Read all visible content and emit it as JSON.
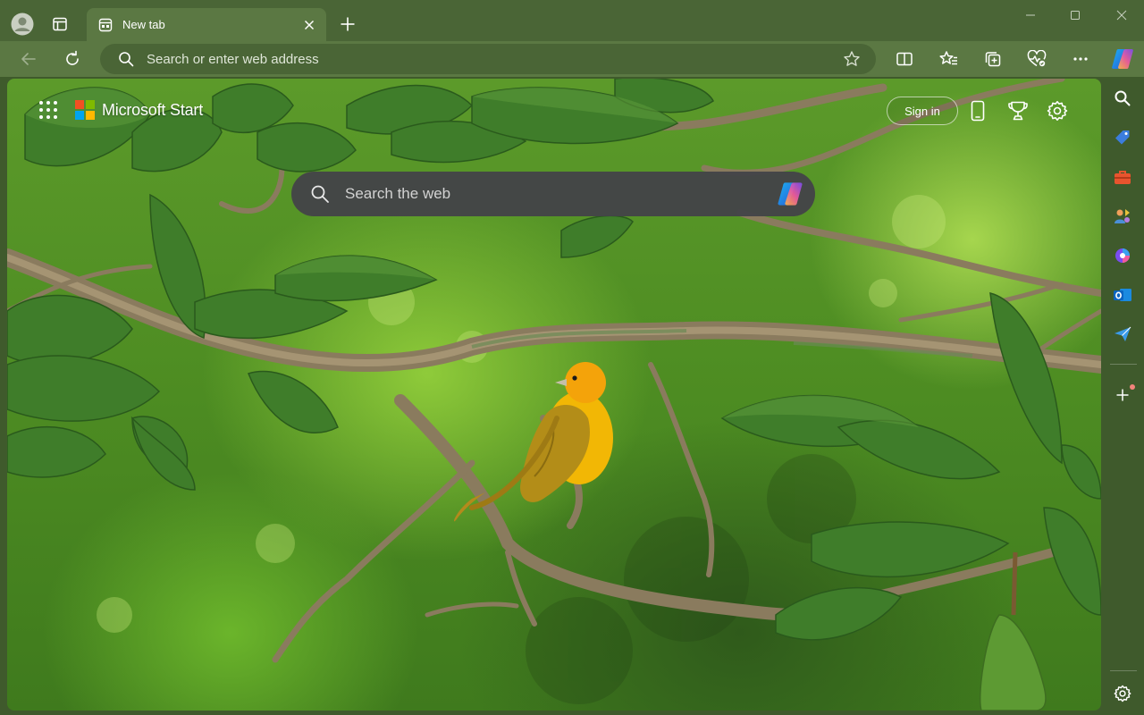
{
  "window": {
    "tab_title": "New tab",
    "minimize_glyph": "—",
    "maximize_glyph": "☐",
    "close_glyph": "✕"
  },
  "toolbar": {
    "address_placeholder": "Search or enter web address"
  },
  "page": {
    "brand": "Microsoft Start",
    "sign_in_label": "Sign in",
    "search_placeholder": "Search the web"
  },
  "icons": {
    "profile": "profile-icon",
    "workspaces": "workspaces-icon",
    "tab_favicon": "new-tab-page-icon",
    "tab_close": "close-icon",
    "new_tab": "plus-icon",
    "back": "back-arrow-icon",
    "refresh": "refresh-icon",
    "address_search": "search-icon",
    "favorite": "star-icon",
    "split_screen": "split-screen-icon",
    "favorites": "favorites-icon",
    "collections": "collections-icon",
    "browser_essentials": "heart-pulse-icon",
    "more": "more-dots-icon",
    "copilot": "copilot-icon",
    "apps": "apps-grid-icon",
    "phone": "phone-icon",
    "rewards": "trophy-icon",
    "settings": "gear-icon",
    "sidebar": [
      "search-icon",
      "shopping-tag-icon",
      "tools-icon",
      "games-icon",
      "copilot-designer-icon",
      "outlook-icon",
      "send-icon",
      "add-icon",
      "gear-icon"
    ]
  },
  "colors": {
    "frame": "#4a6536",
    "toolbar": "#5b7843",
    "ms_logo": [
      "#f25022",
      "#7fba00",
      "#00a4ef",
      "#ffb900"
    ],
    "bird": "#f2b705",
    "notification_dot": "#f2847c"
  }
}
